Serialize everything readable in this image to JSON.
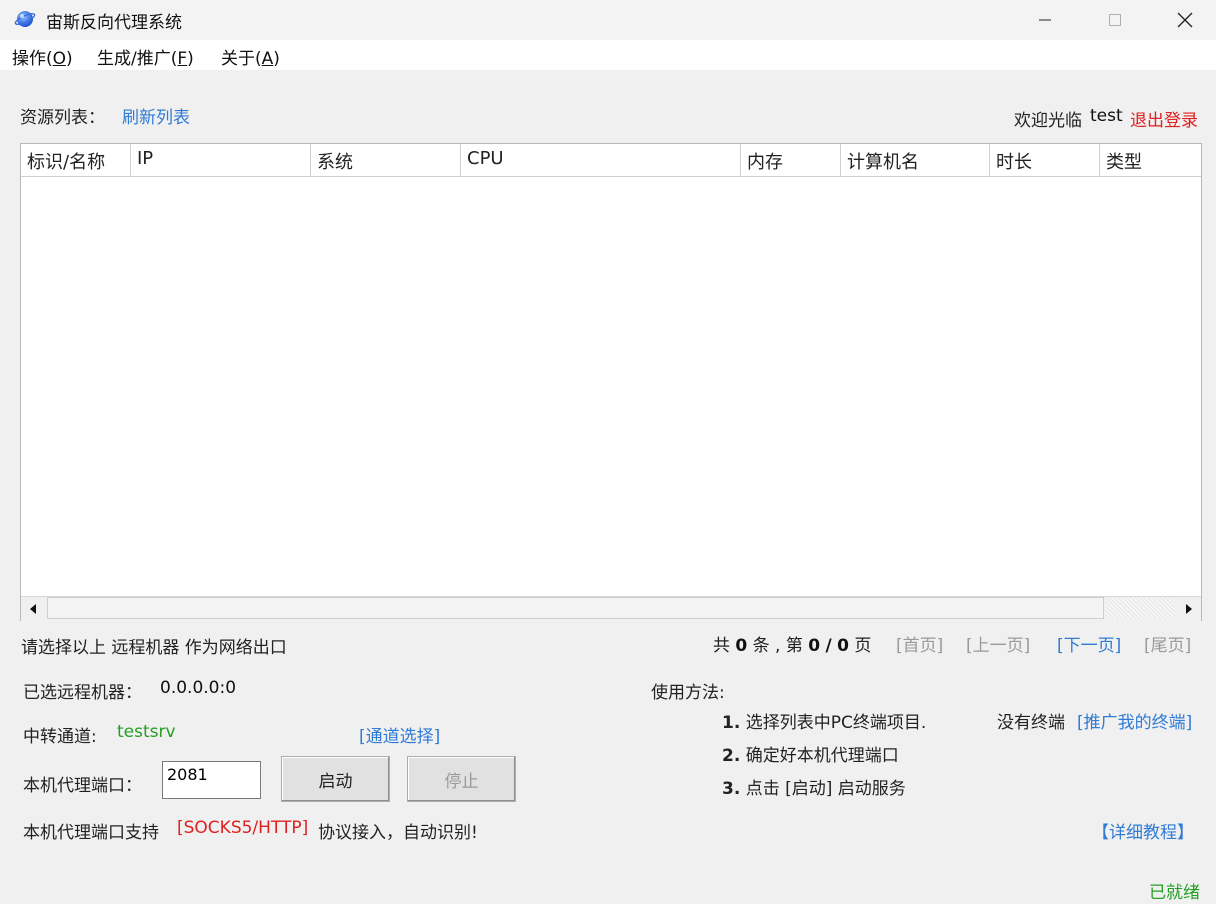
{
  "window": {
    "title": "宙斯反向代理系统",
    "icon": "globe-icon",
    "controls": {
      "minimize": "—",
      "maximize": "☐",
      "close": "✕"
    }
  },
  "menu": [
    {
      "label": "操作(O)",
      "prefix": "操作(",
      "mnemonic": "O",
      "suffix": ")"
    },
    {
      "label": "生成/推广(F)",
      "prefix": "生成/推广(",
      "mnemonic": "F",
      "suffix": ")"
    },
    {
      "label": "关于(A)",
      "prefix": "关于(",
      "mnemonic": "A",
      "suffix": ")"
    }
  ],
  "resources": {
    "label": "资源列表：",
    "refresh_link": "刷新列表"
  },
  "user": {
    "welcome": "欢迎光临",
    "username": "test",
    "logout": "退出登录"
  },
  "table": {
    "columns": [
      "标识/名称",
      "IP",
      "系统",
      "CPU",
      "内存",
      "计算机名",
      "时长",
      "类型"
    ],
    "rows": []
  },
  "hint": "请选择以上 远程机器 作为网络出口",
  "pagination": {
    "total_prefix": "共",
    "total": "0",
    "total_suffix": "条 , 第",
    "current": "0",
    "sep": "/",
    "pages": "0",
    "pages_suffix": "页",
    "first": "[首页]",
    "prev": "[上一页]",
    "next": "[下一页]",
    "last": "[尾页]"
  },
  "selected": {
    "label": "已选远程机器：",
    "value": "0.0.0.0:0"
  },
  "relay": {
    "label": "中转通道:",
    "value": "testsrv",
    "select_link": "[通道选择]"
  },
  "proxy": {
    "label": "本机代理端口：",
    "port": "2081",
    "start": "启动",
    "stop": "停止"
  },
  "support": {
    "prefix": "本机代理端口支持",
    "protocols": "[SOCKS5/HTTP]",
    "suffix": "协议接入，自动识别!"
  },
  "usage": {
    "title": "使用方法:",
    "steps": [
      {
        "num": "1.",
        "text": "选择列表中PC终端项目."
      },
      {
        "num": "2.",
        "text": "确定好本机代理端口"
      },
      {
        "num": "3.",
        "text": "点击 [启动] 启动服务"
      }
    ],
    "no_terminal": "没有终端",
    "promote_link": "[推广我的终端]",
    "tutorial_link": "【详细教程】"
  },
  "status": "已就绪",
  "colors": {
    "link_blue": "#2f7bd6",
    "logout_red": "#e02020",
    "status_green": "#22a022",
    "disabled_gray": "#9a9a9a"
  }
}
